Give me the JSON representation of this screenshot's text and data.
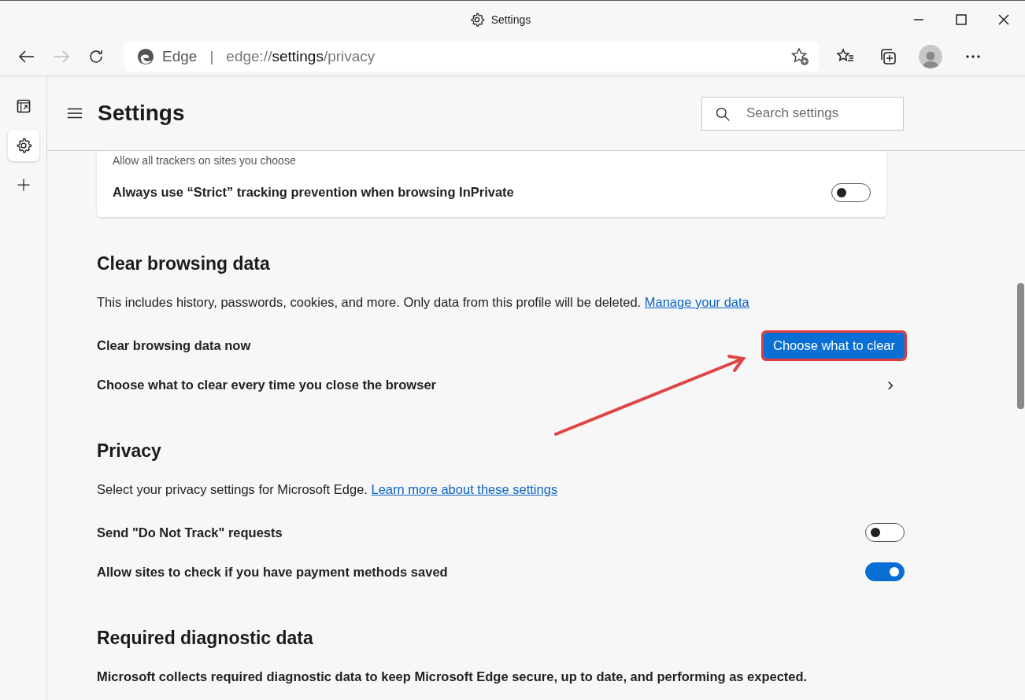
{
  "window": {
    "title": "Settings"
  },
  "address_bar": {
    "site_label": "Edge",
    "separator": "|",
    "url": {
      "scheme": "edge://",
      "host": "settings",
      "path": "/privacy"
    }
  },
  "header": {
    "title": "Settings",
    "search": {
      "placeholder": "Search settings"
    }
  },
  "tracking_card": {
    "caption": "Allow all trackers on sites you choose",
    "rows": [
      {
        "label": "Always use “Strict” tracking prevention when browsing InPrivate",
        "on": false
      }
    ]
  },
  "sections": [
    {
      "title": "Clear browsing data",
      "description": "This includes history, passwords, cookies, and more. Only data from this profile will be deleted.",
      "link": "Manage your data",
      "rows": [
        {
          "kind": "button",
          "label": "Clear browsing data now",
          "button": "Choose what to clear",
          "highlighted": true
        },
        {
          "kind": "chevron",
          "label": "Choose what to clear every time you close the browser",
          "icon": "›"
        }
      ]
    },
    {
      "title": "Privacy",
      "description": "Select your privacy settings for Microsoft Edge.",
      "link": "Learn more about these settings",
      "rows": [
        {
          "kind": "toggle",
          "label": "Send \"Do Not Track\" requests",
          "on": false
        },
        {
          "kind": "toggle",
          "label": "Allow sites to check if you have payment methods saved",
          "on": true
        }
      ]
    },
    {
      "title": "Required diagnostic data",
      "paragraph": "Microsoft collects required diagnostic data to keep Microsoft Edge secure, up to date, and performing as expected."
    }
  ]
}
